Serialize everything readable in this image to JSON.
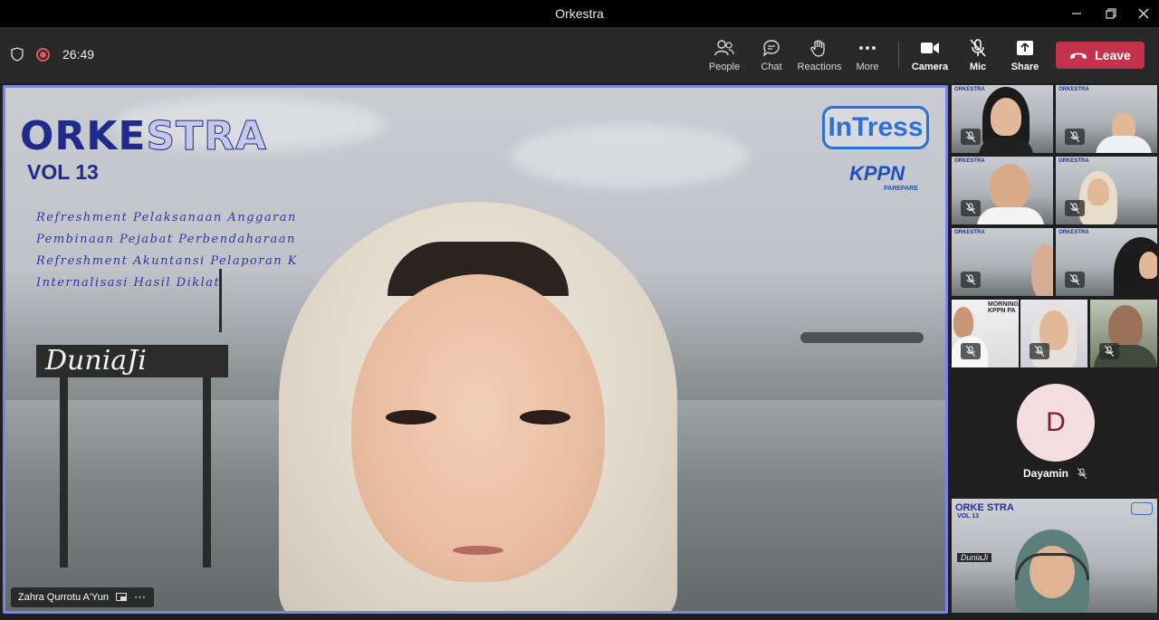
{
  "window": {
    "title": "Orkestra"
  },
  "toolbar": {
    "timer": "26:49",
    "buttons": {
      "people": "People",
      "chat": "Chat",
      "reactions": "Reactions",
      "more": "More",
      "camera": "Camera",
      "mic": "Mic",
      "share": "Share"
    },
    "leave": "Leave"
  },
  "stage": {
    "background": {
      "title_a": "ORKE",
      "title_b": "STRA",
      "volume": "VOL 13",
      "agenda": [
        "Refreshment Pelaksanaan Anggaran",
        "Pembinaan Pejabat Perbendaharaan",
        "Refreshment Akuntansi Pelaporan K",
        "Internalisasi Hasil Diklat"
      ],
      "sign": "DuniaJi",
      "logo_intress": "InTress",
      "logo_kppn": "KPPN",
      "logo_kppn_sub": "PAREPARE"
    },
    "speaker_name": "Zahra Qurrotu A'Yun"
  },
  "gallery": {
    "tile_mini_label": "ORKESTRA",
    "morning_label": "MORNING KPPN PA",
    "avatar_initial": "D",
    "avatar_name": "Dayamin",
    "self_title": "ORKE STRA",
    "self_vol": "VOL 13",
    "self_sign": "DuniaJi"
  },
  "colors": {
    "accent_border": "#7b83eb",
    "leave": "#c4314b",
    "record": "#e05a5a",
    "avatar_bg": "#f3dde1",
    "avatar_fg": "#7a1f30"
  }
}
